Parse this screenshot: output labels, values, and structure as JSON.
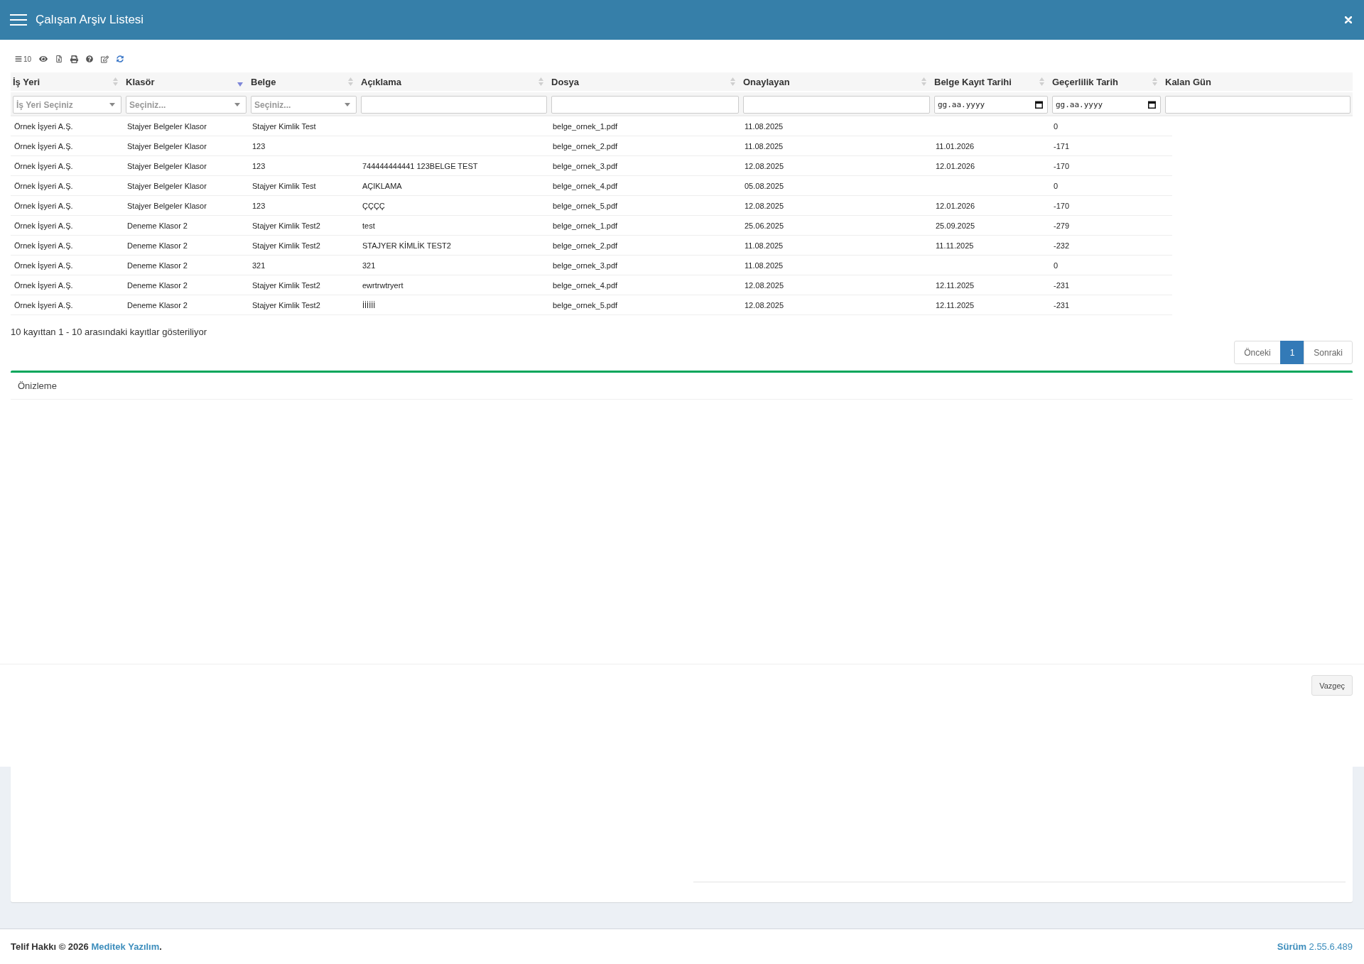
{
  "window": {
    "title": "Çalışan Arşiv Listesi"
  },
  "toolbar": {
    "page_length": "10"
  },
  "table": {
    "columns": [
      {
        "label": "İş Yeri",
        "sortable": true,
        "sorted": false,
        "filter": {
          "kind": "select",
          "placeholder": "İş Yeri Seçiniz"
        }
      },
      {
        "label": "Klasör",
        "sortable": true,
        "sorted": true,
        "filter": {
          "kind": "select",
          "placeholder": "Seçiniz..."
        }
      },
      {
        "label": "Belge",
        "sortable": true,
        "sorted": false,
        "filter": {
          "kind": "select",
          "placeholder": "Seçiniz..."
        }
      },
      {
        "label": "Açıklama",
        "sortable": true,
        "sorted": false,
        "filter": {
          "kind": "text"
        }
      },
      {
        "label": "Dosya",
        "sortable": true,
        "sorted": false,
        "filter": {
          "kind": "text"
        }
      },
      {
        "label": "Onaylayan",
        "sortable": true,
        "sorted": false,
        "filter": {
          "kind": "text"
        }
      },
      {
        "label": "Belge Kayıt Tarihi",
        "sortable": true,
        "sorted": false,
        "filter": {
          "kind": "date",
          "placeholder": "gg.aa.yyyy"
        }
      },
      {
        "label": "Geçerlilik Tarih",
        "sortable": true,
        "sorted": false,
        "filter": {
          "kind": "date",
          "placeholder": "gg.aa.yyyy"
        }
      },
      {
        "label": "Kalan Gün",
        "sortable": false,
        "sorted": false,
        "filter": {
          "kind": "text"
        }
      }
    ],
    "rows": [
      {
        "is_yeri": "Örnek İşyeri A.Ş.",
        "klasor": "Stajyer Belgeler Klasor",
        "belge": "Stajyer Kimlik Test",
        "dosya": "belge_ornek_1.pdf",
        "onaylayan": "11.08.2025",
        "gecerlilik_tarih": "0"
      },
      {
        "is_yeri": "Örnek İşyeri A.Ş.",
        "klasor": "Stajyer Belgeler Klasor",
        "belge": "123",
        "dosya": "belge_ornek_2.pdf",
        "onaylayan": "11.08.2025",
        "belge_kayit_tarihi": "11.01.2026",
        "gecerlilik_tarih": "-171"
      },
      {
        "is_yeri": "Örnek İşyeri A.Ş.",
        "klasor": "Stajyer Belgeler Klasor",
        "belge": "123",
        "aciklama": "744444444441 123BELGE TEST",
        "dosya": "belge_ornek_3.pdf",
        "onaylayan": "12.08.2025",
        "belge_kayit_tarihi": "12.01.2026",
        "gecerlilik_tarih": "-170"
      },
      {
        "is_yeri": "Örnek İşyeri A.Ş.",
        "klasor": "Stajyer Belgeler Klasor",
        "belge": "Stajyer Kimlik Test",
        "aciklama": "AÇIKLAMA",
        "dosya": "belge_ornek_4.pdf",
        "onaylayan": "05.08.2025",
        "gecerlilik_tarih": "0"
      },
      {
        "is_yeri": "Örnek İşyeri A.Ş.",
        "klasor": "Stajyer Belgeler Klasor",
        "belge": "123",
        "aciklama": "ÇÇÇÇ",
        "dosya": "belge_ornek_5.pdf",
        "onaylayan": "12.08.2025",
        "belge_kayit_tarihi": "12.01.2026",
        "gecerlilik_tarih": "-170"
      },
      {
        "is_yeri": "Örnek İşyeri A.Ş.",
        "klasor": "Deneme Klasor 2",
        "belge": "Stajyer Kimlik Test2",
        "aciklama": "test",
        "dosya": "belge_ornek_1.pdf",
        "onaylayan": "25.06.2025",
        "belge_kayit_tarihi": "25.09.2025",
        "gecerlilik_tarih": "-279"
      },
      {
        "is_yeri": "Örnek İşyeri A.Ş.",
        "klasor": "Deneme Klasor 2",
        "belge": "Stajyer Kimlik Test2",
        "aciklama": "STAJYER KİMLİK TEST2",
        "dosya": "belge_ornek_2.pdf",
        "onaylayan": "11.08.2025",
        "belge_kayit_tarihi": "11.11.2025",
        "gecerlilik_tarih": "-232"
      },
      {
        "is_yeri": "Örnek İşyeri A.Ş.",
        "klasor": "Deneme Klasor 2",
        "belge": "321",
        "aciklama": "321",
        "dosya": "belge_ornek_3.pdf",
        "onaylayan": "11.08.2025",
        "gecerlilik_tarih": "0"
      },
      {
        "is_yeri": "Örnek İşyeri A.Ş.",
        "klasor": "Deneme Klasor 2",
        "belge": "Stajyer Kimlik Test2",
        "aciklama": "ewrtrwtryert",
        "dosya": "belge_ornek_4.pdf",
        "onaylayan": "12.08.2025",
        "belge_kayit_tarihi": "12.11.2025",
        "gecerlilik_tarih": "-231"
      },
      {
        "is_yeri": "Örnek İşyeri A.Ş.",
        "klasor": "Deneme Klasor 2",
        "belge": "Stajyer Kimlik Test2",
        "aciklama": "İİİİİİ",
        "dosya": "belge_ornek_5.pdf",
        "onaylayan": "12.08.2025",
        "belge_kayit_tarihi": "12.11.2025",
        "gecerlilik_tarih": "-231"
      }
    ]
  },
  "info": "10 kayıttan 1 - 10 arasındaki kayıtlar gösteriliyor",
  "pagination": [
    {
      "label": "Önceki",
      "selected": false
    },
    {
      "label": "1",
      "selected": true
    },
    {
      "label": "Sonraki",
      "selected": false
    }
  ],
  "preview": {
    "title": "Önizleme"
  },
  "footer_buttons": [
    "Vazgeç"
  ],
  "page_footer": {
    "copyright": "Telif Hakkı © 2026",
    "company": "Meditek Yazılım",
    "suffix": ".",
    "version": "**Sürüm** 2.55.6.489"
  }
}
